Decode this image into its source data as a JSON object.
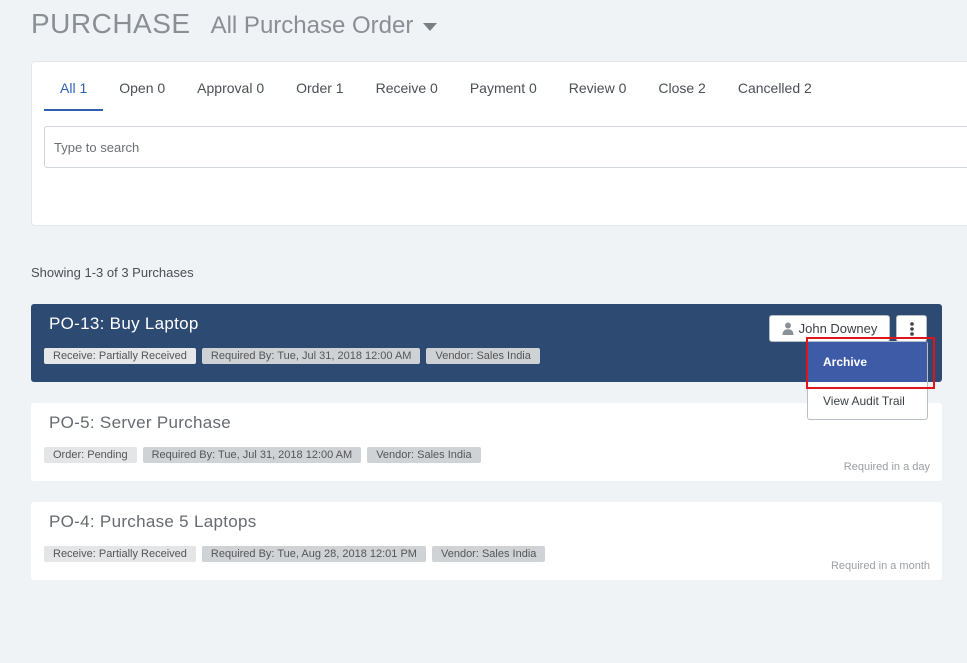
{
  "header": {
    "module": "PURCHASE",
    "view": "All Purchase Order"
  },
  "tabs": [
    {
      "label": "All 1",
      "active": true
    },
    {
      "label": "Open 0"
    },
    {
      "label": "Approval 0"
    },
    {
      "label": "Order 1"
    },
    {
      "label": "Receive 0"
    },
    {
      "label": "Payment 0"
    },
    {
      "label": "Review 0"
    },
    {
      "label": "Close 2"
    },
    {
      "label": "Cancelled 2"
    }
  ],
  "search": {
    "placeholder": "Type to search",
    "value": ""
  },
  "showing": "Showing 1-3 of 3 Purchases",
  "purchases": [
    {
      "title": "PO-13: Buy Laptop",
      "status": "Receive: Partially Received",
      "required_by": "Required By: Tue, Jul 31, 2018 12:00 AM",
      "vendor": "Vendor: Sales India",
      "due": "",
      "selected": true
    },
    {
      "title": "PO-5: Server Purchase",
      "status": "Order: Pending",
      "required_by": "Required By: Tue, Jul 31, 2018 12:00 AM",
      "vendor": "Vendor: Sales India",
      "due": "Required in a day"
    },
    {
      "title": "PO-4: Purchase 5 Laptops",
      "status": "Receive: Partially Received",
      "required_by": "Required By: Tue, Aug 28, 2018 12:01 PM",
      "vendor": "Vendor: Sales India",
      "due": "Required in a month"
    }
  ],
  "owner": {
    "name": "John Downey",
    "icon": "user-icon"
  },
  "more_icon": "vertical-ellipsis-icon",
  "menu": {
    "items": [
      "Archive",
      "View Audit Trail"
    ]
  },
  "colors": {
    "accent": "#2f5fb3",
    "selected_card": "#2d4a73",
    "menu_active": "#3e5ba8",
    "highlight": "#e0141b"
  }
}
